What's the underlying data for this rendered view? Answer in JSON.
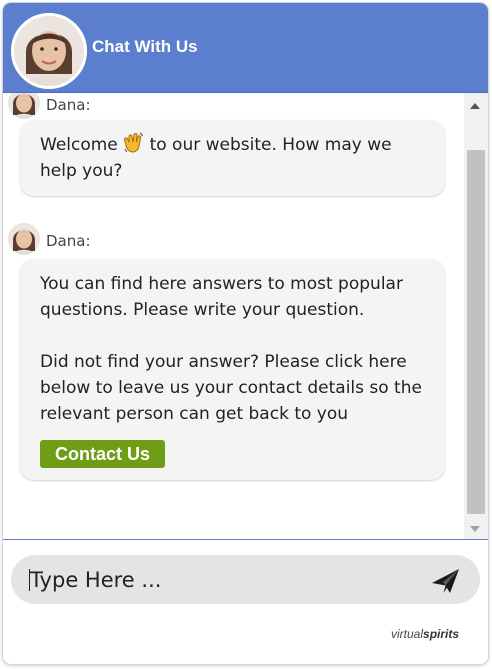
{
  "header": {
    "title": "Chat With Us",
    "avatar_icon": "agent-avatar"
  },
  "messages": [
    {
      "sender": "Dana:",
      "text_before_emoji": "Welcome ",
      "emoji": "👋",
      "text_after_emoji": " to our website. How may we help you?"
    },
    {
      "sender": "Dana:",
      "paragraph1": "You can find here answers to most popular questions. Please write your question.",
      "paragraph2": "Did not find your answer? Please click here below to leave us your contact details so the relevant person can get back to you",
      "button_label": "Contact Us"
    }
  ],
  "composer": {
    "placeholder": "Type Here ...",
    "send_icon": "paper-plane-icon"
  },
  "branding": {
    "prefix": "virtual",
    "suffix": "spirits"
  },
  "colors": {
    "header": "#5b7fce",
    "button": "#6f9d16",
    "bubble": "#f4f4f4",
    "input": "#e4e4e4"
  }
}
